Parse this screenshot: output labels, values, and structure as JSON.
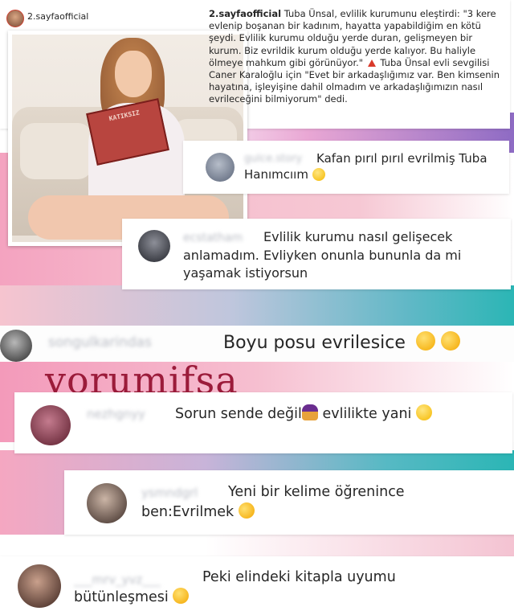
{
  "post": {
    "username": "2.sayfaofficial",
    "caption_user": "2.sayfaofficial",
    "caption_body": "Tuba Ünsal, evlilik kurumunu eleştirdi: \"3 kere evlenip boşanan bir kadınım, hayatta yapabildiğim en kötü şeydi. Evlilik kurumu olduğu yerde duran, gelişmeyen bir kurum. Biz evrildik kurum olduğu yerde kalıyor. Bu haliyle ölmeye mahkum gibi görünüyor.\"",
    "caption_tail": "Tuba Ünsal evli sevgilisi Caner Karaloğlu için \"Evet bir arkadaşlığımız var. Ben kimsenin hayatına, işleyişine dahil olmadım ve arkadaşlığımızın nasıl evrileceğini bilmiyorum\" dedi.",
    "book_title": "KATIKSIZ"
  },
  "watermark": "yorumifsa",
  "comments": [
    {
      "username": "gulce.story",
      "text": "Kafan pırıl pırıl evrilmiş Tuba Hanımcıım",
      "emoji": [
        "smile-emoji"
      ]
    },
    {
      "username": "ecstatham",
      "text": "Evlilik kurumu nasıl gelişecek anlamadım. Evliyken onunla bununla da mi yaşamak istiyorsun",
      "emoji": []
    },
    {
      "username": "songulkarindas",
      "text": "Boyu posu evrilesice",
      "emoji": [
        "wink-emoji",
        "rofl-emoji"
      ]
    },
    {
      "username": "nezhgnyy",
      "text_a": "Sorun sende değil",
      "text_b": "evlilikte yani",
      "emoji": [
        "person-shrugging-emoji",
        "grimace-emoji"
      ]
    },
    {
      "username": "ysmndgrl",
      "text": "Yeni bir kelime öğrenince ben:Evrilmek",
      "emoji": [
        "rofl-emoji"
      ]
    },
    {
      "username": "___mrv_yvz___",
      "text": "Peki elindeki kitapla uyumu bütünleşmesi",
      "emoji": [
        "tears-of-joy-emoji"
      ]
    }
  ],
  "colors": {
    "pink": "#f4a3c0",
    "purple": "#8e6bc4",
    "teal": "#2bb6b5",
    "watermark": "#9b1b3a",
    "warning": "#d93a2b"
  }
}
